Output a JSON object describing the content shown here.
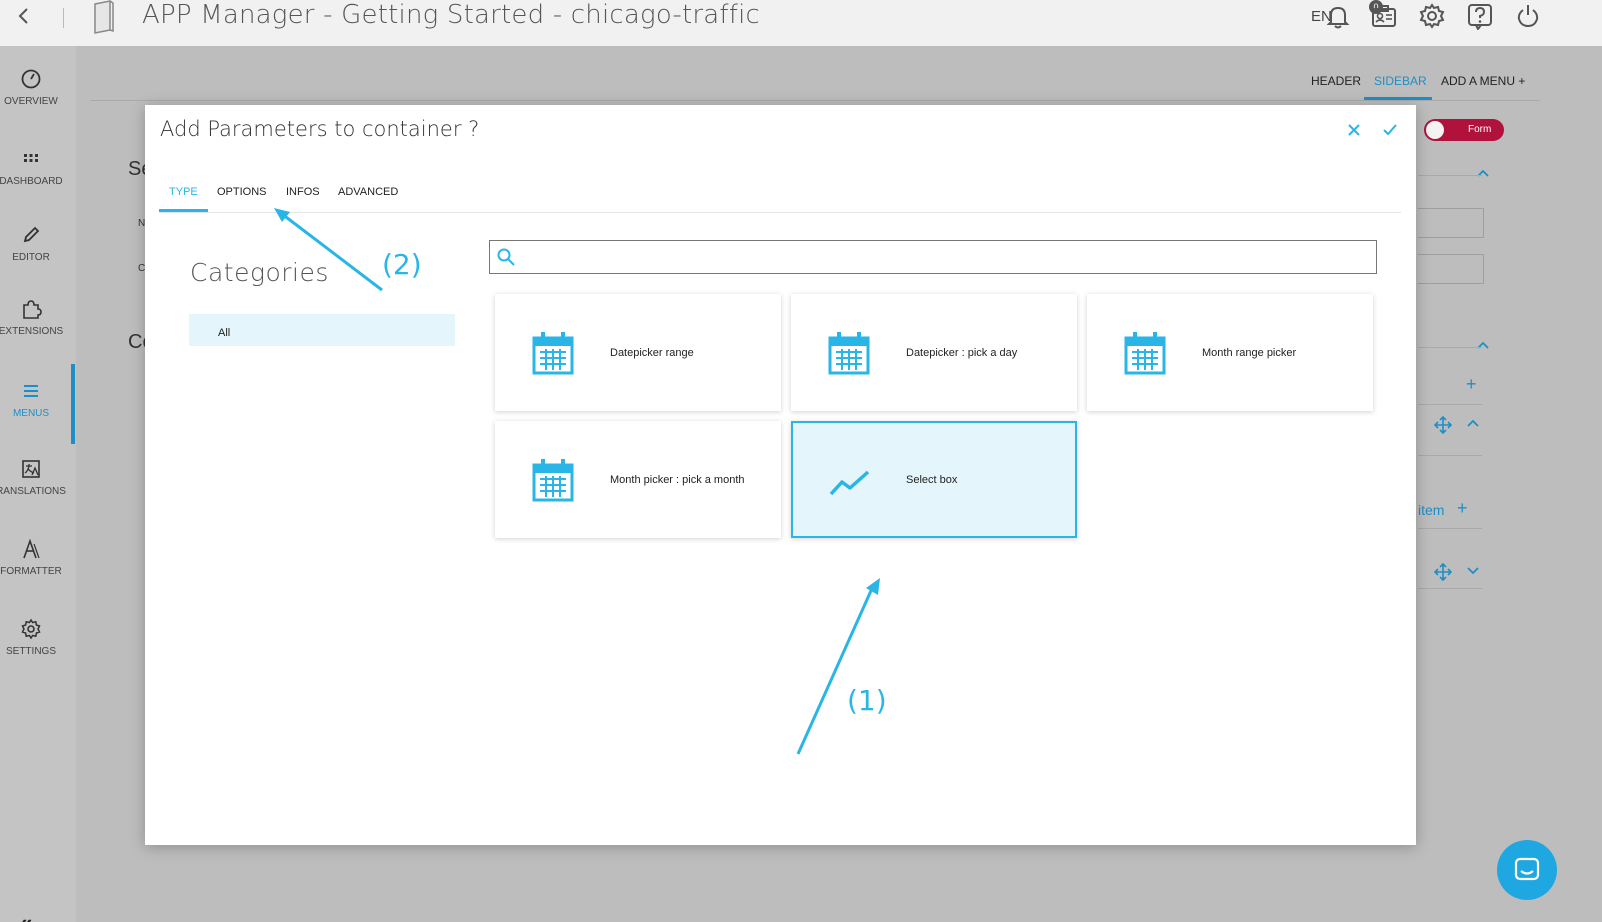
{
  "topbar": {
    "title": "APP Manager - Getting Started - chicago-traffic",
    "language": "EN",
    "notification_count": "0"
  },
  "sidebar": {
    "items": [
      {
        "label": "OVERVIEW",
        "icon": "gauge-icon"
      },
      {
        "label": "DASHBOARD",
        "icon": "grid-icon"
      },
      {
        "label": "EDITOR",
        "icon": "pencil-icon"
      },
      {
        "label": "EXTENSIONS",
        "icon": "puzzle-icon"
      },
      {
        "label": "MENUS",
        "icon": "menu-icon"
      },
      {
        "label": "RANSLATIONS",
        "icon": "translate-icon"
      },
      {
        "label": "FORMATTER",
        "icon": "formatter-icon"
      },
      {
        "label": "SETTINGS",
        "icon": "gear-icon"
      }
    ],
    "active": "MENUS",
    "collapse_glyph": "«"
  },
  "page": {
    "tabs": [
      "HEADER",
      "SIDEBAR",
      "ADD A MENU"
    ],
    "add_menu_glyph": "+",
    "active_tab": "SIDEBAR",
    "toggle_label": "Form",
    "partial_letters": [
      "Se",
      "N",
      "C",
      "Co"
    ],
    "partial_text": "item",
    "plus_glyph": "+"
  },
  "modal": {
    "title": "Add Parameters to container ?",
    "tabs": [
      "TYPE",
      "OPTIONS",
      "INFOS",
      "ADVANCED"
    ],
    "active_tab": "TYPE",
    "categories_heading": "Categories",
    "categories": [
      "All"
    ],
    "search_placeholder": "",
    "cards": [
      {
        "label": "Datepicker range",
        "icon": "calendar-icon",
        "selected": false
      },
      {
        "label": "Datepicker : pick a day",
        "icon": "calendar-icon",
        "selected": false
      },
      {
        "label": "Month range picker",
        "icon": "calendar-icon",
        "selected": false
      },
      {
        "label": "Month picker : pick a month",
        "icon": "calendar-icon",
        "selected": false
      },
      {
        "label": "Select box",
        "icon": "line-chart-icon",
        "selected": true
      }
    ]
  },
  "annotations": {
    "label_1": "(1)",
    "label_2": "(2)"
  },
  "colors": {
    "accent": "#29b6e6",
    "toggle": "#b0123c",
    "overlay": "#bdbdbd"
  }
}
